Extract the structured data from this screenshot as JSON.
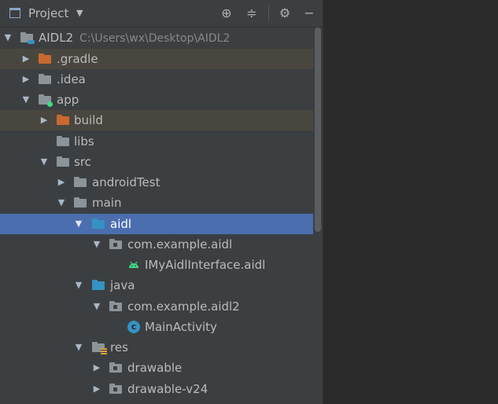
{
  "toolbar": {
    "title": "Project",
    "caret": "▼",
    "locate_glyph": "⊕",
    "collapse_glyph": "≑",
    "settings_glyph": "⚙",
    "hide_glyph": "−"
  },
  "tree": {
    "rows": [
      {
        "name": "AIDL2",
        "path": "C:\\Users\\wx\\Desktop\\AIDL2",
        "arrow": "▼",
        "icon": "module-folder-icon"
      },
      {
        "name": ".gradle",
        "arrow": "▶",
        "icon": "excluded-folder-icon"
      },
      {
        "name": ".idea",
        "arrow": "▶",
        "icon": "folder-icon"
      },
      {
        "name": "app",
        "arrow": "▼",
        "icon": "android-module-folder-icon"
      },
      {
        "name": "build",
        "arrow": "▶",
        "icon": "excluded-folder-icon"
      },
      {
        "name": "libs",
        "arrow": "",
        "icon": "folder-icon"
      },
      {
        "name": "src",
        "arrow": "▼",
        "icon": "folder-icon"
      },
      {
        "name": "androidTest",
        "arrow": "▶",
        "icon": "folder-icon"
      },
      {
        "name": "main",
        "arrow": "▼",
        "icon": "folder-icon"
      },
      {
        "name": "aidl",
        "arrow": "▼",
        "icon": "source-folder-icon"
      },
      {
        "name": "com.example.aidl",
        "arrow": "▼",
        "icon": "package-icon"
      },
      {
        "name": "IMyAidlInterface.aidl",
        "arrow": "",
        "icon": "android-icon"
      },
      {
        "name": "java",
        "arrow": "▼",
        "icon": "source-folder-icon"
      },
      {
        "name": "com.example.aidl2",
        "arrow": "▼",
        "icon": "package-icon"
      },
      {
        "name": "MainActivity",
        "arrow": "",
        "icon": "class-icon",
        "icon_letter": "c"
      },
      {
        "name": "res",
        "arrow": "▼",
        "icon": "resource-folder-icon"
      },
      {
        "name": "drawable",
        "arrow": "▶",
        "icon": "package-icon"
      },
      {
        "name": "drawable-v24",
        "arrow": "▶",
        "icon": "package-icon"
      }
    ]
  },
  "colors": {
    "panel_bg": "#3c3f41",
    "selection": "#4b6eaf",
    "excluded_row": "#49463f",
    "folder": "#8c9499",
    "excluded_folder": "#c96930",
    "source_folder": "#3592c4",
    "android_green": "#3ddc84"
  }
}
